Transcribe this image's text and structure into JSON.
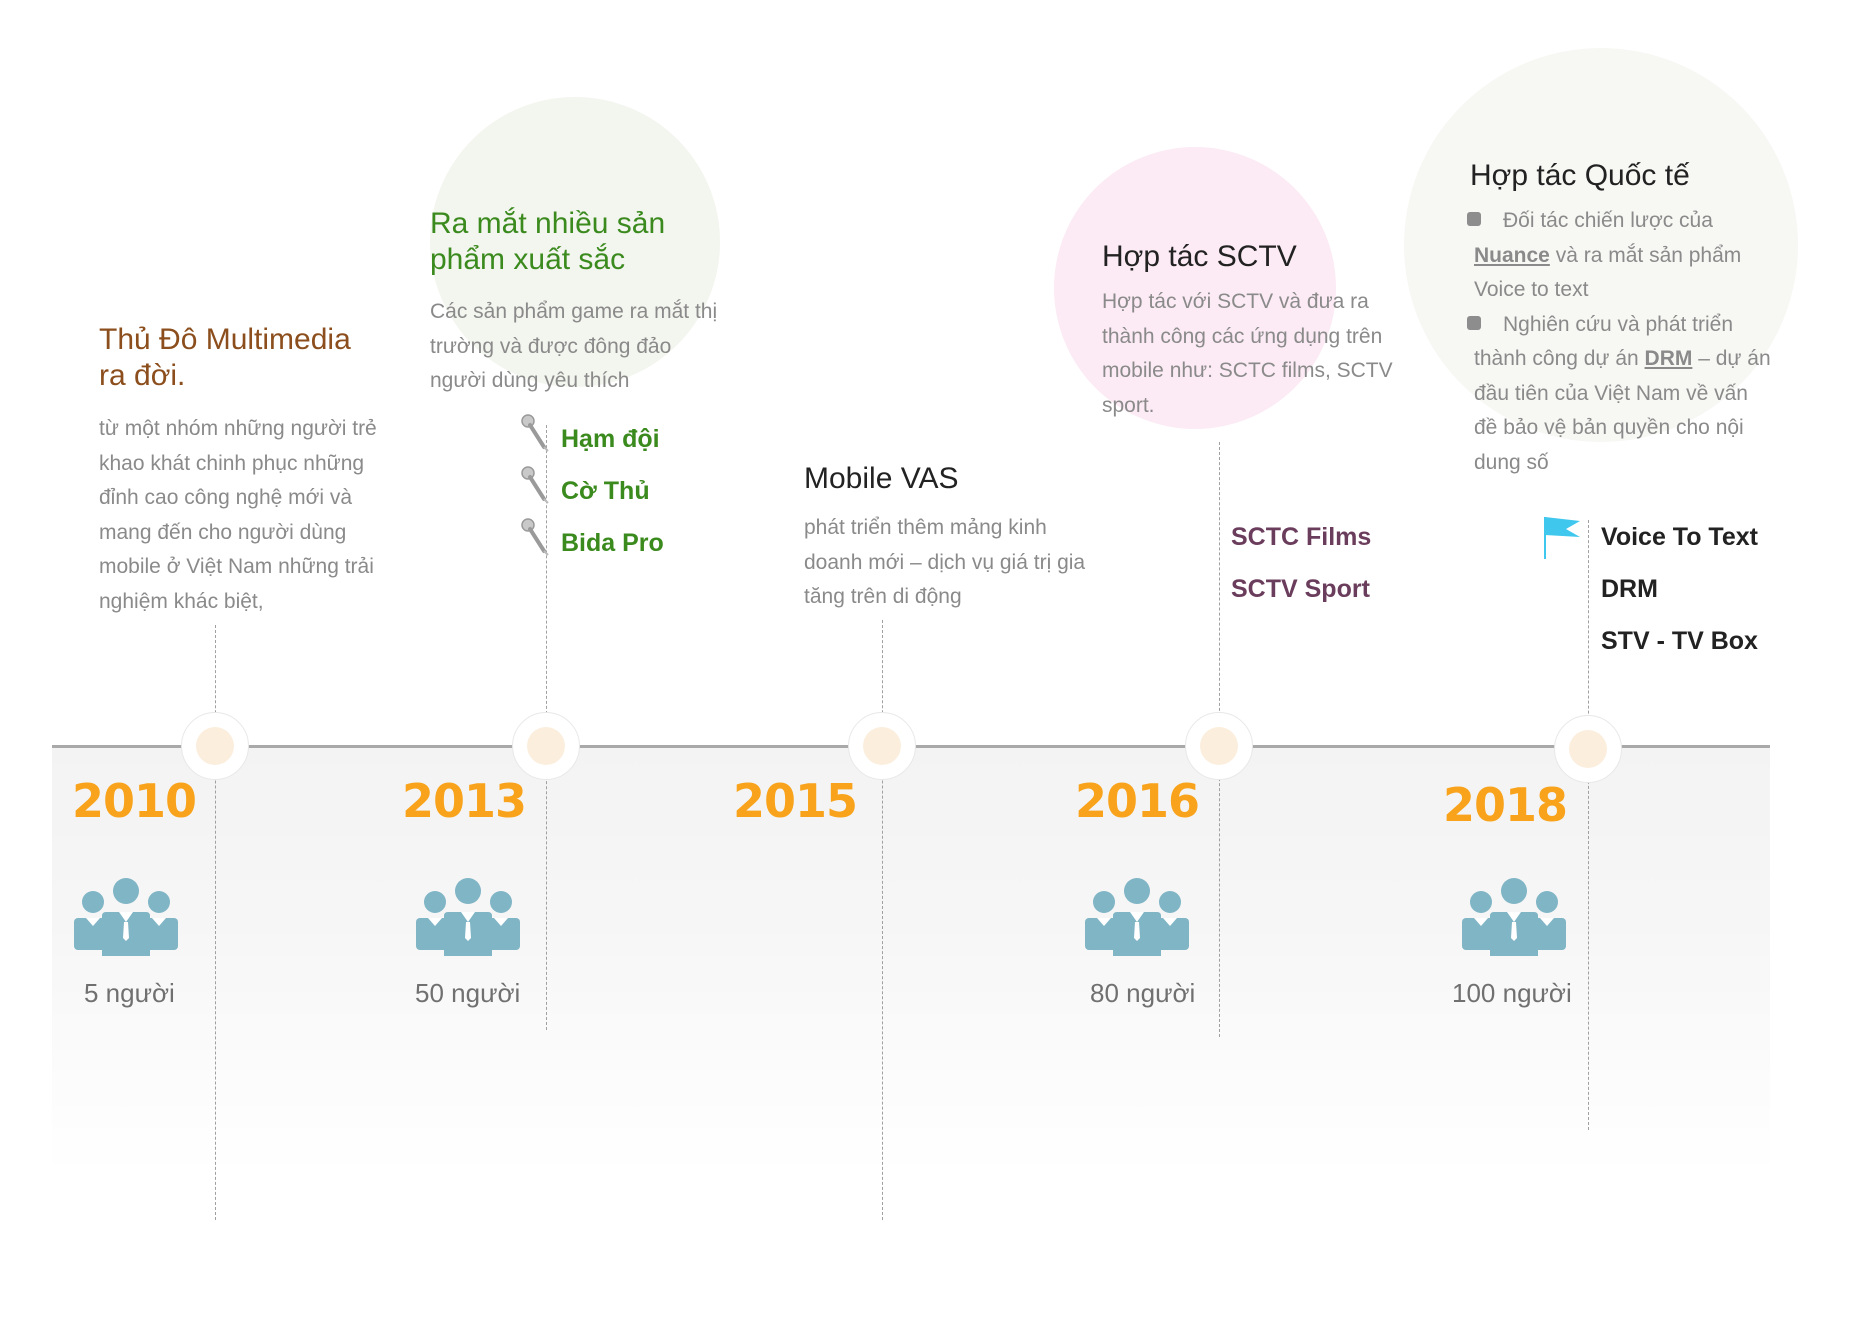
{
  "years": [
    "2010",
    "2013",
    "2015",
    "2016",
    "2018"
  ],
  "headcounts": [
    "5 người",
    "50 người",
    "80 người",
    "100 người"
  ],
  "milestone_2010": {
    "title": "Thủ Đô Multimedia ra đời.",
    "description": "từ một nhóm những người trẻ khao khát chinh phục những đỉnh cao công nghệ mới và mang đến cho người dùng mobile ở Việt Nam những trải nghiệm khác biệt,"
  },
  "milestone_2013": {
    "title": "Ra mắt nhiều sản phẩm xuất sắc",
    "description": "Các sản phẩm game ra mắt thị trường và được đông đảo người dùng yêu thích",
    "products": [
      "Hạm đội",
      "Cờ Thủ",
      "Bida Pro"
    ]
  },
  "milestone_2015": {
    "title": "Mobile VAS",
    "description": "phát triển thêm mảng kinh doanh mới – dịch vụ giá trị gia tăng trên di động"
  },
  "milestone_2016": {
    "title": "Hợp tác SCTV",
    "description": "Hợp tác với SCTV và đưa ra thành công các ứng dụng trên mobile như: SCTC films, SCTV sport.",
    "products": [
      "SCTC Films",
      "SCTV Sport"
    ]
  },
  "milestone_2018": {
    "title": "Hợp tác Quốc tế",
    "bullet1_pre": "Đối tác chiến lược của",
    "bullet1_link": "Nuance",
    "bullet1_post": "và ra mắt sản phẩm Voice to text",
    "bullet2_pre": "Nghiên cứu và phát triển thành công dự án",
    "bullet2_link": "DRM",
    "bullet2_post": "– dự án đầu tiên của Việt Nam về vấn đề bảo vệ bản quyền cho nội dung số",
    "products": [
      "Voice To Text",
      "DRM",
      "STV - TV Box"
    ]
  },
  "colors": {
    "year": "#f8a31b",
    "people_icon": "#7fb5c5",
    "title_2010": "#8b4e1c",
    "title_2013": "#3b8a1e",
    "title_dark": "#222222",
    "sctv_products": "#6b3d5c",
    "flag": "#3fc7ee"
  }
}
